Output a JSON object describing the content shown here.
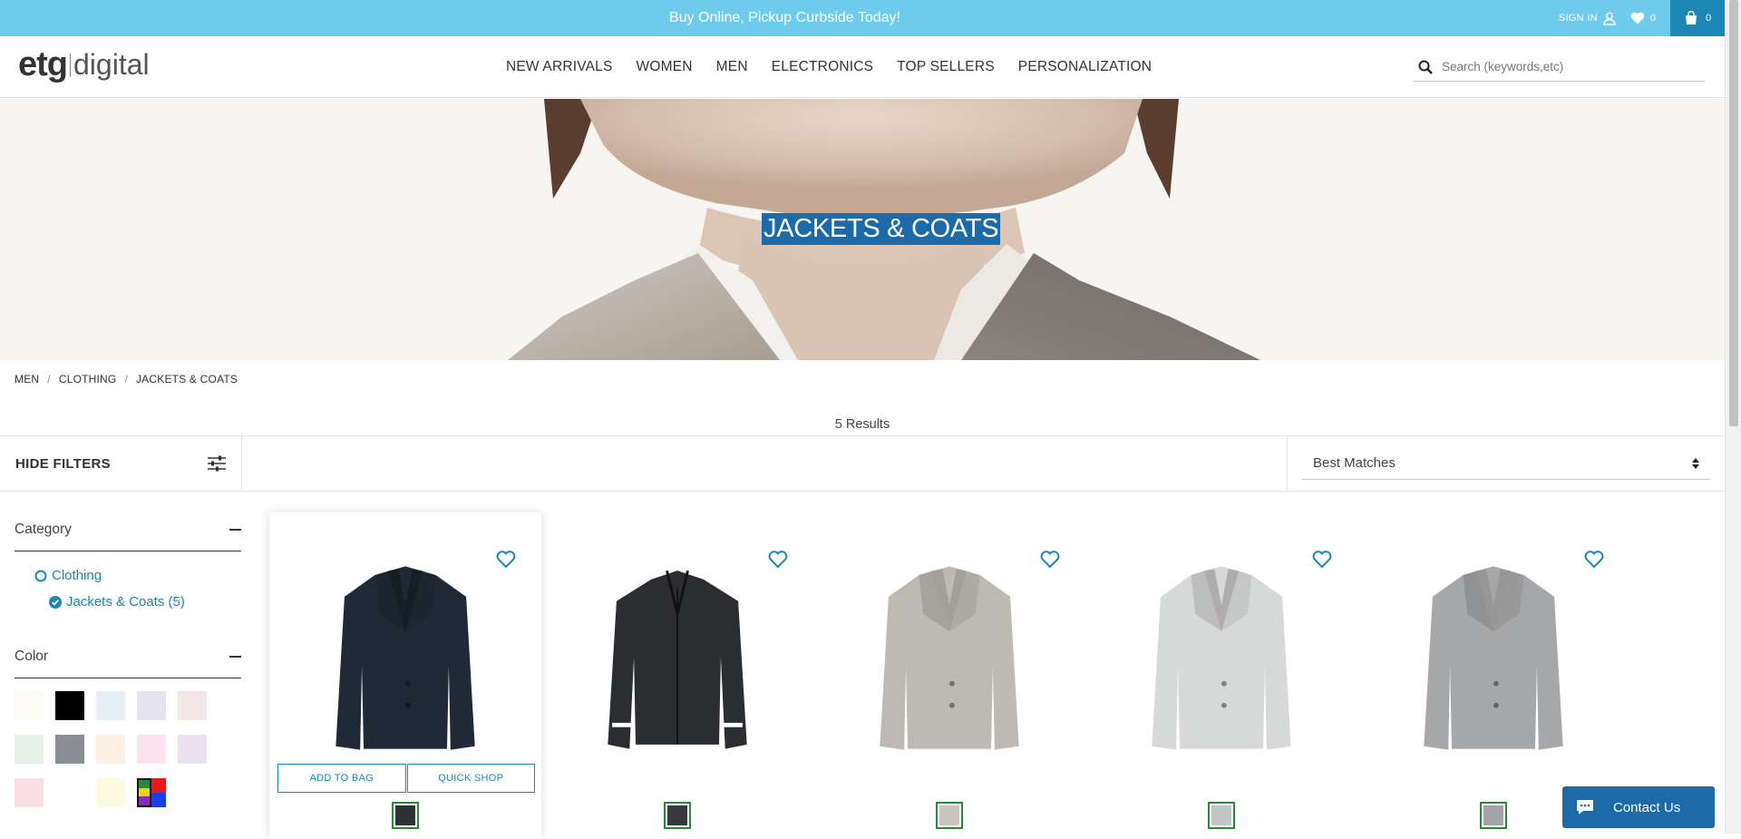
{
  "promo": {
    "text": "Buy Online, Pickup Curbside Today!"
  },
  "account": {
    "signin_label": "SIGN IN",
    "wishlist_count": "0",
    "bag_count": "0"
  },
  "logo": {
    "brand": "etg",
    "suffix": "digital"
  },
  "nav": [
    "NEW ARRIVALS",
    "WOMEN",
    "MEN",
    "ELECTRONICS",
    "TOP SELLERS",
    "PERSONALIZATION"
  ],
  "search": {
    "placeholder": "Search (keywords,etc)"
  },
  "hero": {
    "title": "JACKETS & COATS"
  },
  "breadcrumb": [
    "MEN",
    "CLOTHING",
    "JACKETS & COATS"
  ],
  "results": "5 Results",
  "toolbar": {
    "hide_filters_label": "HIDE FILTERS",
    "sort_value": "Best Matches"
  },
  "filters": {
    "category": {
      "title": "Category",
      "items": [
        "Clothing",
        "Jackets & Coats (5)"
      ]
    },
    "color": {
      "title": "Color",
      "swatches": [
        "#fdfbf5",
        "#000000",
        "#e6eef8",
        "#e5e3ef",
        "#f4e6e6",
        "#e6f2e8",
        "#8a8e92",
        "#fdf1e6",
        "#fbe3ef",
        "#ece1f1",
        "#fbdfe4",
        "#ffffff",
        "#fcfbdf",
        "multi"
      ]
    }
  },
  "products": [
    {
      "color": "#1f2a36",
      "swatch": "#2c3236",
      "add_label": "ADD TO BAG",
      "quick_label": "QUICK SHOP"
    },
    {
      "color": "#2b2d30",
      "swatch": "#36383a"
    },
    {
      "color": "#bdbab4",
      "swatch": "#c9c6bd"
    },
    {
      "color": "#d7d8d8",
      "swatch": "#c4c6c6"
    },
    {
      "color": "#a6a7a8",
      "swatch": "#a3a4a5"
    }
  ],
  "contact": {
    "label": "Contact Us"
  }
}
